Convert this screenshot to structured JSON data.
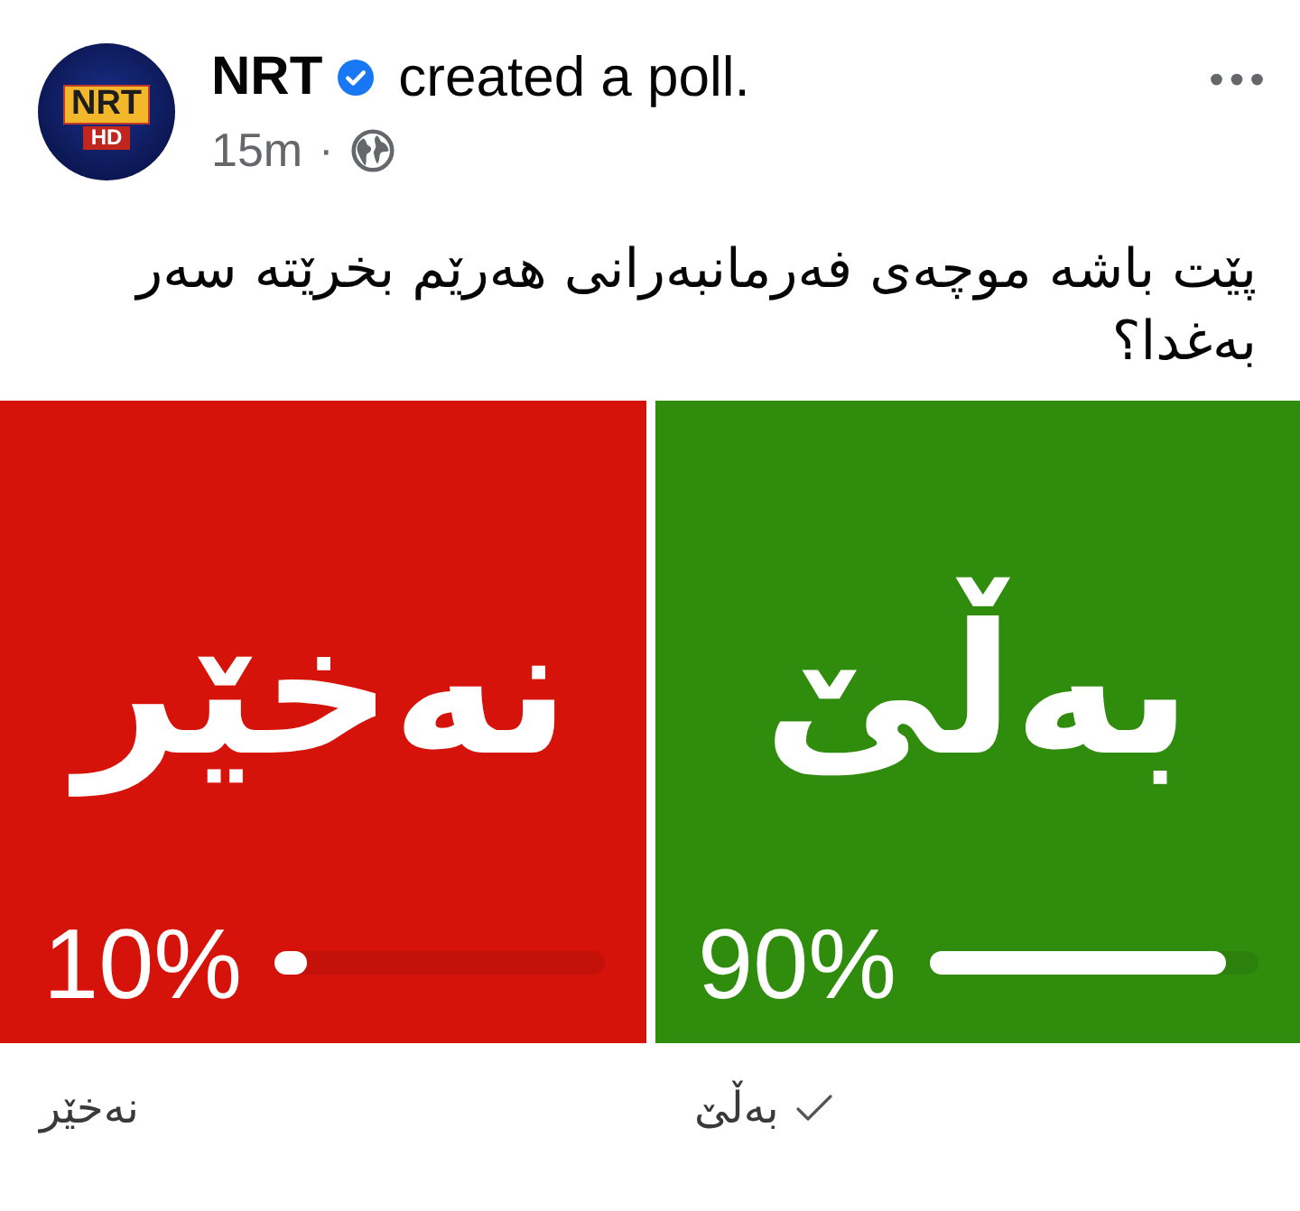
{
  "post": {
    "avatar": {
      "logo_text": "NRT",
      "logo_badge": "HD"
    },
    "author": "NRT",
    "verified": true,
    "action": "created a poll.",
    "time": "15m",
    "separator": "·"
  },
  "question": "پێت باشە موچەی فەرمانبەرانی هەرێم بخرێتە سەر بەغدا؟",
  "options": [
    {
      "label": "بەڵێ",
      "percent": "90%",
      "level": 0.9,
      "color": "#2f8c0c",
      "caption": "بەڵێ",
      "selected": true
    },
    {
      "label": "نەخێر",
      "percent": "10%",
      "level": 0.1,
      "color": "#d5130a",
      "caption": "نەخێر",
      "selected": false
    }
  ]
}
